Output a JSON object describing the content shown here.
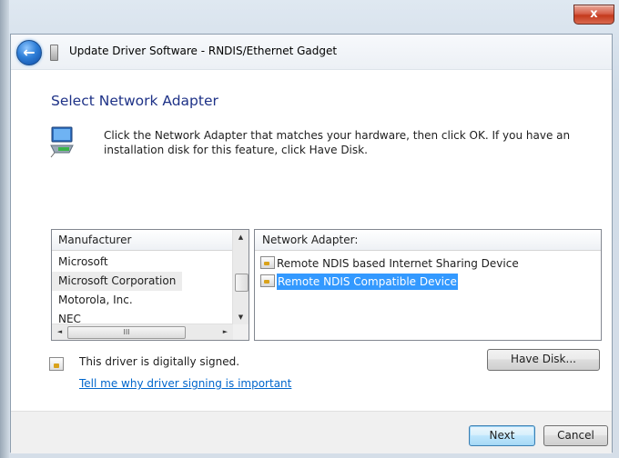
{
  "window": {
    "title": "Update Driver Software - RNDIS/Ethernet Gadget",
    "close_glyph": "x"
  },
  "page": {
    "title": "Select Network Adapter",
    "instruction": "Click the Network Adapter that matches your hardware, then click OK. If you have an installation disk for this feature, click Have Disk."
  },
  "manufacturer_list": {
    "header": "Manufacturer",
    "items": [
      "Microsoft",
      "Microsoft Corporation",
      "Motorola, Inc.",
      "NEC"
    ],
    "selected": "Microsoft Corporation",
    "scroll_glyphs": {
      "up": "▲",
      "down": "▼",
      "left": "◄",
      "right": "►",
      "grip": "III"
    }
  },
  "adapter_list": {
    "header": "Network Adapter:",
    "items": [
      "Remote NDIS based Internet Sharing Device",
      "Remote NDIS Compatible Device"
    ],
    "selected": "Remote NDIS Compatible Device"
  },
  "signature": {
    "text": "This driver is digitally signed.",
    "link": "Tell me why driver signing is important"
  },
  "buttons": {
    "have_disk": "Have Disk...",
    "next": "Next",
    "cancel": "Cancel",
    "back_glyph": "←"
  },
  "colors": {
    "title_blue": "#1e3287",
    "selection": "#3399ff",
    "link": "#0066cc",
    "close_red": "#c4391c"
  },
  "icons": {
    "back": "back-arrow-icon",
    "device": "usb-device-icon",
    "network": "network-adapter-icon",
    "adapter_item": "network-card-icon",
    "certificate": "certificate-icon"
  }
}
